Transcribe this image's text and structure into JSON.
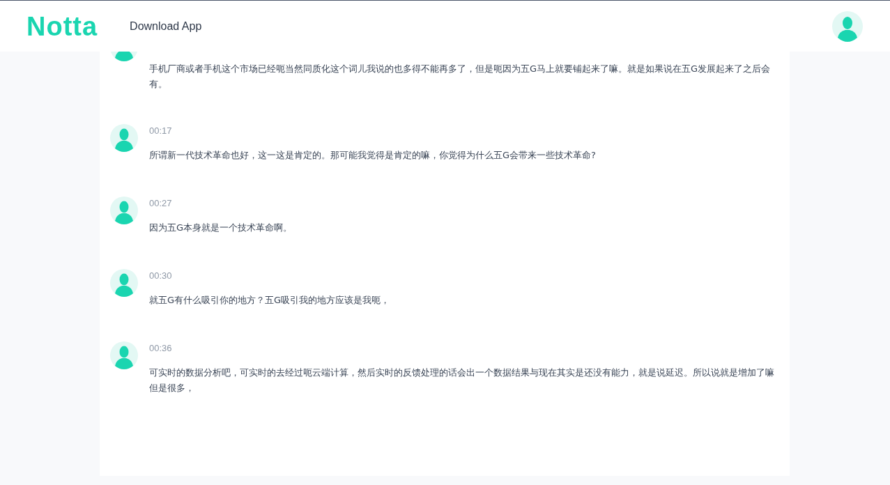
{
  "header": {
    "logo": "Notta",
    "download_link": "Download App"
  },
  "segments": [
    {
      "text": "手机厂商或者手机这个市场已经呃当然同质化这个词儿我说的也多得不能再多了，但是呃因为五G马上就要铺起来了嘛。就是如果说在五G发展起来了之后会有。"
    },
    {
      "time": "00:17",
      "text": "所谓新一代技术革命也好，这一这是肯定的。那可能我觉得是肯定的嘛，你觉得为什么五G会带来一些技术革命?"
    },
    {
      "time": "00:27",
      "text": "因为五G本身就是一个技术革命啊。"
    },
    {
      "time": "00:30",
      "text": "就五G有什么吸引你的地方？五G吸引我的地方应该是我呃，"
    },
    {
      "time": "00:36",
      "text": "可实时的数据分析吧，可实时的去经过呃云端计算，然后实时的反馈处理的话会出一个数据结果与现在其实是还没有能力，就是说延迟。所以说就是增加了嘛但是很多，"
    }
  ]
}
